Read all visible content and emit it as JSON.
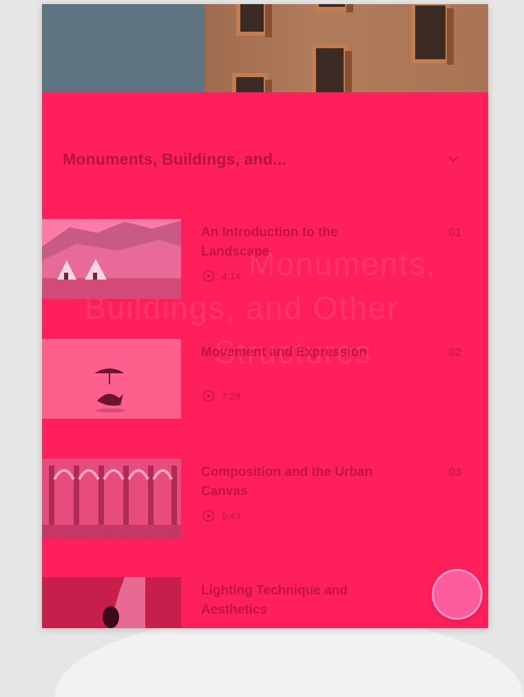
{
  "header": {
    "title": "Monuments, Buildings, and...",
    "chevron_icon": "chevron-down-icon"
  },
  "background_text": [
    "Monuments,",
    "Buildings, and Other",
    "Structures"
  ],
  "lessons": [
    {
      "title": "An Introduction to the Landscape",
      "duration": "4:14",
      "number": "01"
    },
    {
      "title": "Movement and Expression",
      "duration": "7:28",
      "number": "02"
    },
    {
      "title": "Composition and the Urban Canvas",
      "duration": "5:43",
      "number": "03"
    },
    {
      "title": "Lighting Technique and Aesthetics"
    }
  ],
  "colors": {
    "accent": "#ff1f5a",
    "fab": "#ff5c9e",
    "text_muted": "#820a32"
  },
  "icons": {
    "play": "play-circle-icon",
    "fab": "fab-button"
  }
}
